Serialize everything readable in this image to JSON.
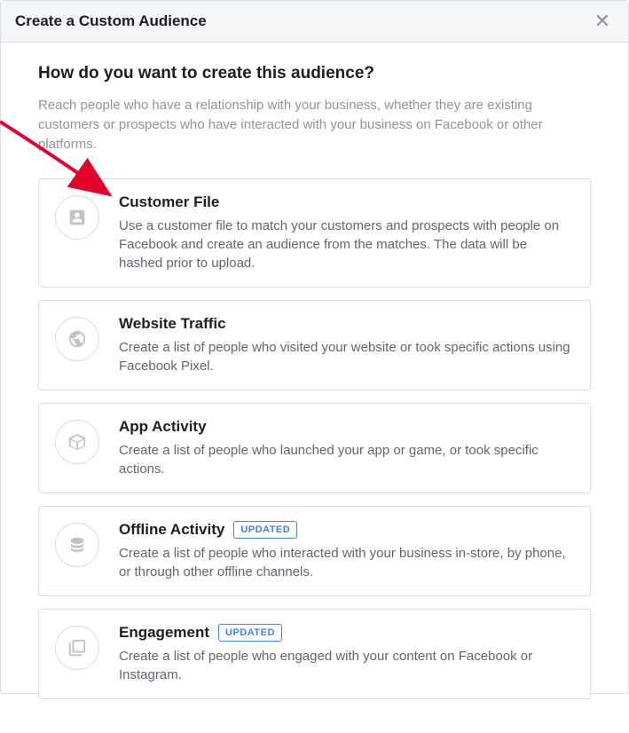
{
  "header": {
    "title": "Create a Custom Audience"
  },
  "question": "How do you want to create this audience?",
  "subtext": "Reach people who have a relationship with your business, whether they are existing customers or prospects who have interacted with your business on Facebook or other platforms.",
  "options": [
    {
      "title": "Customer File",
      "desc": "Use a customer file to match your customers and prospects with people on Facebook and create an audience from the matches. The data will be hashed prior to upload.",
      "badge": null
    },
    {
      "title": "Website Traffic",
      "desc": "Create a list of people who visited your website or took specific actions using Facebook Pixel.",
      "badge": null
    },
    {
      "title": "App Activity",
      "desc": "Create a list of people who launched your app or game, or took specific actions.",
      "badge": null
    },
    {
      "title": "Offline Activity",
      "desc": "Create a list of people who interacted with your business in-store, by phone, or through other offline channels.",
      "badge": "UPDATED"
    },
    {
      "title": "Engagement",
      "desc": "Create a list of people who engaged with your content on Facebook or Instagram.",
      "badge": "UPDATED"
    }
  ]
}
